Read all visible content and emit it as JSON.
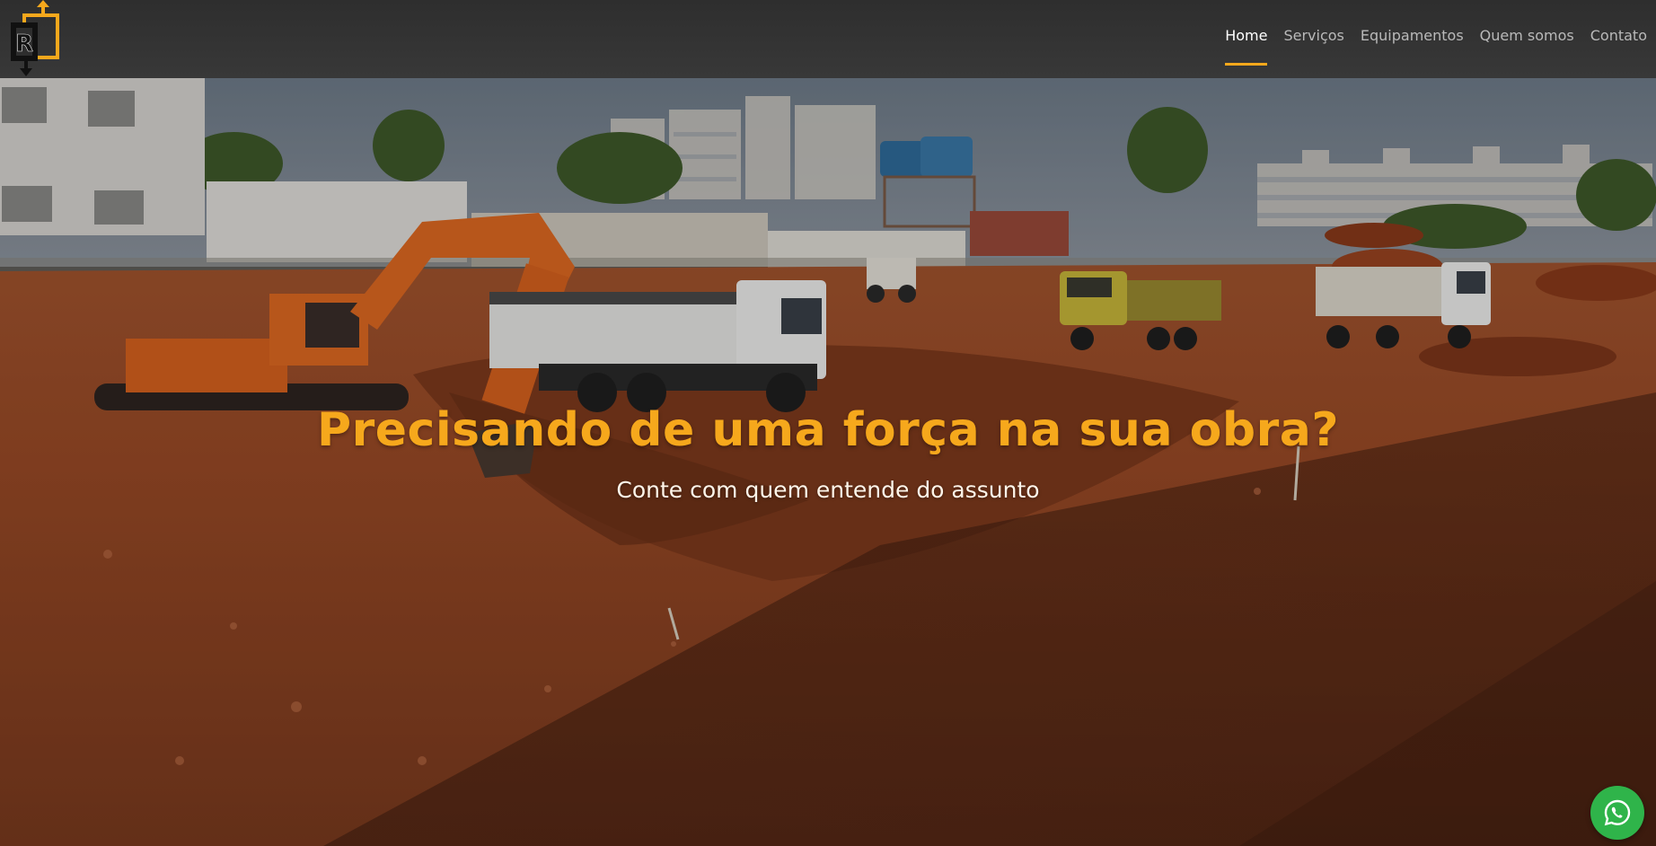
{
  "brand": {
    "logo_letter": "R",
    "accent_color": "#f6a81c"
  },
  "nav": {
    "items": [
      {
        "label": "Home",
        "active": true
      },
      {
        "label": "Serviços",
        "active": false
      },
      {
        "label": "Equipamentos",
        "active": false
      },
      {
        "label": "Quem somos",
        "active": false
      },
      {
        "label": "Contato",
        "active": false
      }
    ]
  },
  "hero": {
    "title": "Precisando de uma força na sua obra?",
    "subtitle": "Conte com quem entende do assunto"
  },
  "floating": {
    "icon": "whatsapp-icon",
    "color": "#2fb44a"
  }
}
